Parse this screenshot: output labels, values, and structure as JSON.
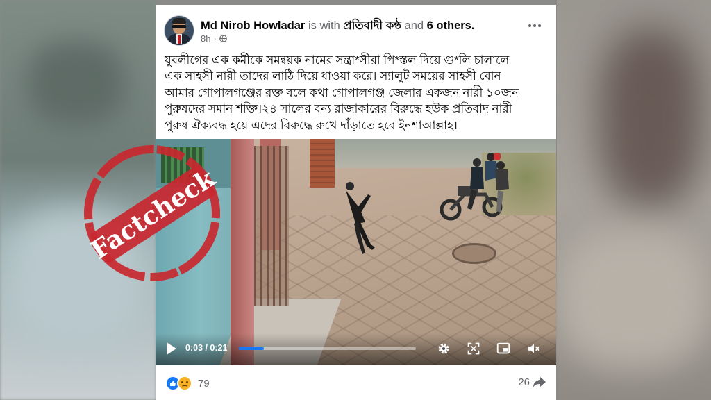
{
  "post": {
    "author": "Md Nirob Howladar",
    "with_text": "is with",
    "with_name": "প্রতিবাদী কন্ঠ",
    "and_text": "and",
    "others": "6 others.",
    "time": "8h",
    "body_lines": [
      "যুবলীগের এক কর্মীকে সমন্বয়ক নামের সন্ত্রা*সীরা পি*স্তল দিয়ে গু*লি চালালে",
      "এক সাহসী নারী তাদের লাঠি দিয়ে ধাওয়া করে। স্যালুট সময়ের সাহসী বোন",
      "আমার গোপালগঞ্জের রক্ত বলে কথা গোপালগঞ্জ জেলার একজন নারী ১০জন",
      "পুরুষদের সমান শক্তি।২৪ সালের  বন্য রাজাকারের বিরুদ্ধে হউক প্রতিবাদ নারী",
      "পুরুষ ঐক্যবদ্ধ হয়ে এদের বিরুদ্ধে রুখে দাঁড়াতে হবে ইনশাআল্লাহ।"
    ]
  },
  "video": {
    "time": "0:03 / 0:21",
    "progress": 0.143
  },
  "footer": {
    "reaction_count": "79",
    "share_count": "26"
  },
  "stamp": {
    "text": "Factcheck",
    "color": "#c8282f"
  },
  "icons": {
    "more": "more-icon",
    "globe": "globe-icon",
    "play": "play-icon",
    "settings": "gear-icon",
    "fullscreen": "fullscreen-icon",
    "pip": "picture-in-picture-icon",
    "volume": "mute-icon",
    "like": "like-icon",
    "sad": "sad-icon",
    "share": "share-icon"
  },
  "colors": {
    "accent": "#1877f2",
    "text": "#050505",
    "muted": "#65676b"
  }
}
